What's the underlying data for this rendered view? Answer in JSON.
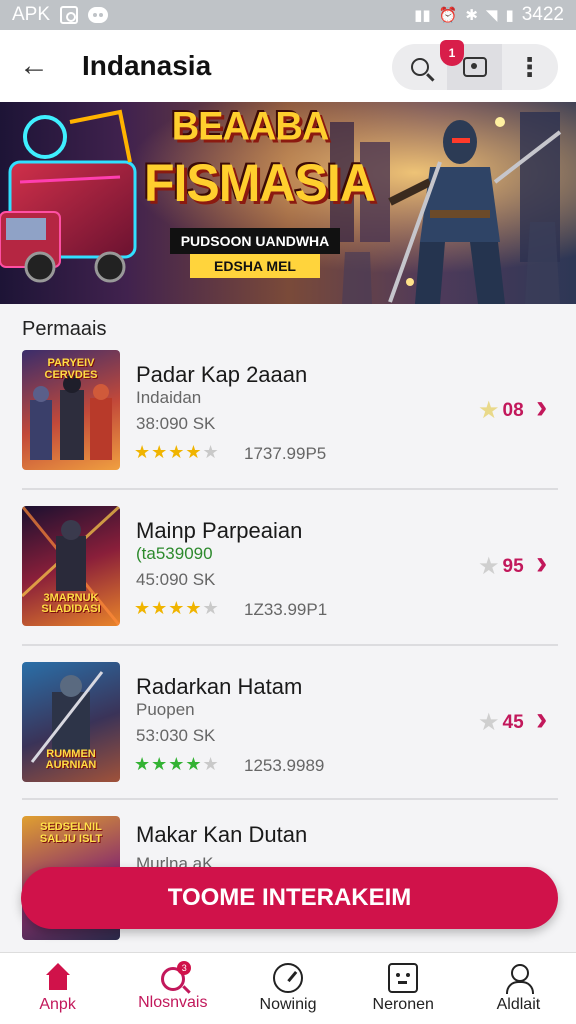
{
  "status_bar": {
    "left_text": "APK",
    "time": "3422",
    "icons": [
      "photo-icon",
      "pill-icon",
      "signal-icon",
      "alarm-icon",
      "bluetooth-icon",
      "wifi-icon",
      "battery-icon"
    ]
  },
  "app_bar": {
    "title": "Indanasia",
    "back_icon": "arrow-left-icon",
    "notification_count": "1"
  },
  "banner": {
    "title_line1": "BEAABA",
    "title_line2": "FISMASIA",
    "strip1": "PUDSOON UANDWHA",
    "strip2": "EDSHA MEL"
  },
  "list": {
    "heading": "Permaais",
    "items": [
      {
        "title": "Padar Kap 2aaan",
        "subtitle": "Indaidan",
        "size": "38:090 SK",
        "rating_stars": 4,
        "price": "1737.99P5",
        "score": "08",
        "thumb_label": "PARYEIV CERVDES",
        "subtitle_green": false,
        "stars_color": "gold"
      },
      {
        "title": "Mainp Parpeaian",
        "subtitle": "(ta539090",
        "size": "45:090 SK",
        "rating_stars": 4,
        "price": "1Z33.99P1",
        "score": "95",
        "thumb_label": "3MARNUK SLADIDASI",
        "subtitle_green": true,
        "stars_color": "gold"
      },
      {
        "title": "Radarkan Hatam",
        "subtitle": "Puopen",
        "size": "53:030 SK",
        "rating_stars": 4,
        "price": "1253.9989",
        "score": "45",
        "thumb_label": "RUMMEN AURNIAN",
        "subtitle_green": false,
        "stars_color": "green"
      },
      {
        "title": "Makar Kan Dutan",
        "subtitle": "Murlna aK",
        "thumb_label": "SEDSELNIL SALJU ISLT"
      }
    ]
  },
  "cta": {
    "label": "TOOME INTERAKEIM"
  },
  "bottom_nav": {
    "items": [
      {
        "label": "Anpk",
        "icon": "home-icon",
        "active": true
      },
      {
        "label": "Nlosnvais",
        "icon": "search-icon",
        "active": true,
        "badge": "3"
      },
      {
        "label": "Nowinig",
        "icon": "gauge-icon",
        "active": false
      },
      {
        "label": "Neronen",
        "icon": "box-icon",
        "active": false
      },
      {
        "label": "Aldlait",
        "icon": "user-icon",
        "active": false
      }
    ]
  },
  "colors": {
    "accent": "#d0124a",
    "accent_text": "#c2185b",
    "star_gold": "#f0b400",
    "star_green": "#33b233"
  }
}
